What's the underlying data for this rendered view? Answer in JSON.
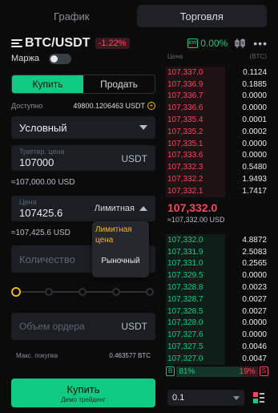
{
  "tabs": [
    "График",
    "Торговля"
  ],
  "header": {
    "pair": "BTC/USDT",
    "change": "-1.22%",
    "kw_badge": "KW",
    "kw_value": "0.00%",
    "more": "•••"
  },
  "form": {
    "margin_label": "Маржа",
    "buy_tab": "Купить",
    "sell_tab": "Продать",
    "available_label": "Доступно",
    "available_value": "49800.1206463 USDT",
    "order_type": "Условный",
    "trigger_label": "Триггер. цена",
    "trigger_value": "107000",
    "trigger_unit": "USDT",
    "trigger_approx": "≈107,000.00 USD",
    "price_label": "Цена",
    "price_value": "107425.6",
    "price_type": "Лимитная",
    "price_approx": "≈107,425.6 USD",
    "qty_placeholder": "Количество",
    "amount_placeholder": "Объем ордера",
    "amount_unit": "USDT",
    "maxbuy_label": "Макс. покупка",
    "maxbuy_value": "0.463577 BTC",
    "buy_button": "Купить",
    "buy_button_sub": "Демо трейдинг"
  },
  "slider": {
    "value_percent": 0,
    "steps": 5
  },
  "dropdown": {
    "items": [
      "Лимитная цена",
      "Рыночный"
    ],
    "selected_index": 0
  },
  "orderbook": {
    "head_price": "Цена",
    "head_qty": "(BTC)",
    "asks": [
      {
        "price": "107,337.0",
        "qty": "0.1124"
      },
      {
        "price": "107,336.9",
        "qty": "0.1885"
      },
      {
        "price": "107,336.7",
        "qty": "0.0000"
      },
      {
        "price": "107,336.6",
        "qty": "0.0000"
      },
      {
        "price": "107,335.4",
        "qty": "0.0001"
      },
      {
        "price": "107,335.2",
        "qty": "0.0002"
      },
      {
        "price": "107,335.1",
        "qty": "0.0000"
      },
      {
        "price": "107,333.6",
        "qty": "0.0000"
      },
      {
        "price": "107,332.3",
        "qty": "0.5480"
      },
      {
        "price": "107,332.2",
        "qty": "1.9493"
      },
      {
        "price": "107,332.1",
        "qty": "1.7417"
      }
    ],
    "mid_price": "107,332.0",
    "mid_usd": "≈107,332.00 USD",
    "bids": [
      {
        "price": "107,332.0",
        "qty": "4.8872"
      },
      {
        "price": "107,331.9",
        "qty": "2.5083"
      },
      {
        "price": "107,331.0",
        "qty": "0.2565"
      },
      {
        "price": "107,329.5",
        "qty": "0.0000"
      },
      {
        "price": "107,328.8",
        "qty": "0.0023"
      },
      {
        "price": "107,328.7",
        "qty": "0.0027"
      },
      {
        "price": "107,328.5",
        "qty": "0.0027"
      },
      {
        "price": "107,328.0",
        "qty": "0.0000"
      },
      {
        "price": "107,327.6",
        "qty": "0.0000"
      },
      {
        "price": "107,327.5",
        "qty": "0.0046"
      },
      {
        "price": "107,327.0",
        "qty": "0.0047"
      }
    ],
    "buy_badge": "B",
    "buy_ratio": "81%",
    "sell_ratio": "19%",
    "sell_badge": "S",
    "depth": "0.1"
  },
  "colors": {
    "buy": "#0ecb81",
    "sell": "#f6465d",
    "accent": "#f0b90b"
  }
}
